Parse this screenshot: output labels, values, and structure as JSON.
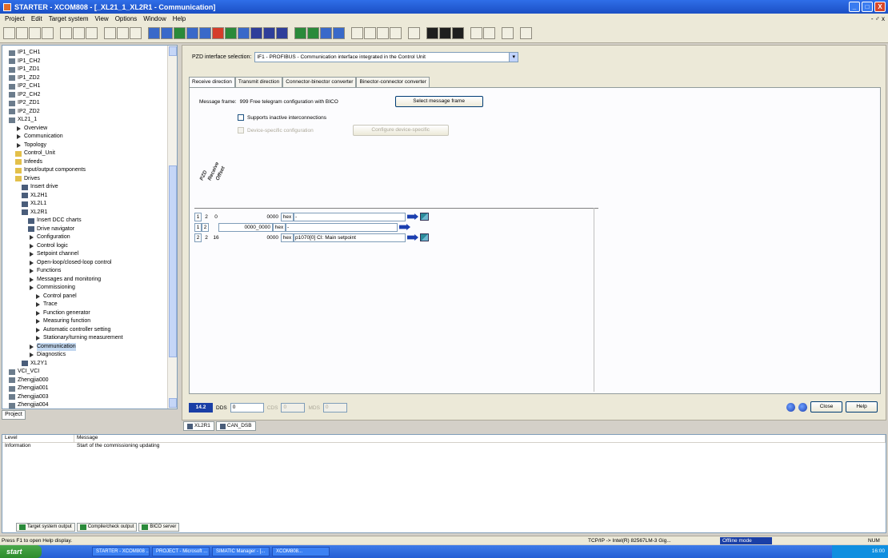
{
  "window": {
    "title": "STARTER - XCOM808 - [_XL21_1_XL2R1 - Communication]",
    "controls": [
      "_",
      "□",
      "X"
    ]
  },
  "menu": {
    "items": [
      "Project",
      "Edit",
      "Target system",
      "View",
      "Options",
      "Window",
      "Help"
    ],
    "mdi_controls": "- ♂ x"
  },
  "tree": {
    "items": [
      {
        "label": "IP1_CH1",
        "type": "device",
        "indent": 0
      },
      {
        "label": "IP1_CH2",
        "type": "device",
        "indent": 0
      },
      {
        "label": "IP1_ZD1",
        "type": "device",
        "indent": 0
      },
      {
        "label": "IP1_ZD2",
        "type": "device",
        "indent": 0
      },
      {
        "label": "IP2_CH1",
        "type": "device",
        "indent": 0
      },
      {
        "label": "IP2_CH2",
        "type": "device",
        "indent": 0
      },
      {
        "label": "IP2_ZD1",
        "type": "device",
        "indent": 0
      },
      {
        "label": "IP2_ZD2",
        "type": "device",
        "indent": 0
      },
      {
        "label": "XL21_1",
        "type": "device",
        "indent": 0
      },
      {
        "label": "Overview",
        "type": "arrow",
        "indent": 1
      },
      {
        "label": "Communication",
        "type": "arrow",
        "indent": 1
      },
      {
        "label": "Topology",
        "type": "arrow",
        "indent": 1
      },
      {
        "label": "Control_Unit",
        "type": "folder",
        "indent": 1
      },
      {
        "label": "Infeeds",
        "type": "folder",
        "indent": 1
      },
      {
        "label": "Input/output components",
        "type": "folder",
        "indent": 1
      },
      {
        "label": "Drives",
        "type": "folder",
        "indent": 1
      },
      {
        "label": "Insert drive",
        "type": "drive",
        "indent": 2
      },
      {
        "label": "XL2H1",
        "type": "drive",
        "indent": 2
      },
      {
        "label": "XL2L1",
        "type": "drive",
        "indent": 2
      },
      {
        "label": "XL2R1",
        "type": "drive",
        "indent": 2
      },
      {
        "label": "Insert DCC charts",
        "type": "drive",
        "indent": 3
      },
      {
        "label": "Drive navigator",
        "type": "drive",
        "indent": 3
      },
      {
        "label": "Configuration",
        "type": "arrow",
        "indent": 3
      },
      {
        "label": "Control logic",
        "type": "arrow",
        "indent": 3
      },
      {
        "label": "Setpoint channel",
        "type": "arrow",
        "indent": 3
      },
      {
        "label": "Open-loop/closed-loop control",
        "type": "arrow",
        "indent": 3
      },
      {
        "label": "Functions",
        "type": "arrow",
        "indent": 3
      },
      {
        "label": "Messages and monitoring",
        "type": "arrow",
        "indent": 3
      },
      {
        "label": "Commissioning",
        "type": "arrow",
        "indent": 3
      },
      {
        "label": "Control panel",
        "type": "arrow",
        "indent": 4
      },
      {
        "label": "Trace",
        "type": "arrow",
        "indent": 4
      },
      {
        "label": "Function generator",
        "type": "arrow",
        "indent": 4
      },
      {
        "label": "Measuring function",
        "type": "arrow",
        "indent": 4
      },
      {
        "label": "Automatic controller setting",
        "type": "arrow",
        "indent": 4
      },
      {
        "label": "Stationary/turning measurement",
        "type": "arrow",
        "indent": 4
      },
      {
        "label": "Communication",
        "type": "arrow",
        "indent": 3,
        "selected": true
      },
      {
        "label": "Diagnostics",
        "type": "arrow",
        "indent": 3
      },
      {
        "label": "XL2Y1",
        "type": "drive",
        "indent": 2
      },
      {
        "label": "VCI_VCI",
        "type": "device",
        "indent": 0
      },
      {
        "label": "Zhengjia000",
        "type": "device",
        "indent": 0
      },
      {
        "label": "Zhengjia001",
        "type": "device",
        "indent": 0
      },
      {
        "label": "Zhengjia003",
        "type": "device",
        "indent": 0
      },
      {
        "label": "Zhengjia004",
        "type": "device",
        "indent": 0
      }
    ],
    "project_tab": "Project"
  },
  "pzd": {
    "label": "PZD interface selection:",
    "selected": "IF1 - PROFIBUS - Communication interface integrated in the Control Unit"
  },
  "tabs": [
    {
      "label": "Receive direction",
      "active": true
    },
    {
      "label": "Transmit direction",
      "active": false
    },
    {
      "label": "Connector-binector converter",
      "active": false
    },
    {
      "label": "Binector-connector converter",
      "active": false
    }
  ],
  "message": {
    "label": "Message frame:",
    "value": "999 Free telegram configuration with BICO",
    "select_button": "Select message frame",
    "checkbox1": "Supports inactive interconnections",
    "checkbox2": "Device-specific configuration",
    "disabled_button": "Configure device-specific"
  },
  "columns": [
    "PZD",
    "Receive",
    "Offset"
  ],
  "rows": [
    {
      "pzd": "1",
      "len": "2",
      "offset": "0",
      "value": "0000",
      "hex": "hex",
      "signal": "-"
    },
    {
      "pzd": "1",
      "len": "2",
      "offset": "",
      "value": "0000_0000",
      "hex": "hex",
      "signal": "-"
    },
    {
      "pzd": "2",
      "len": "2",
      "offset": "16",
      "value": "0000",
      "hex": "hex",
      "signal": "p1070[0] CI: Main setpoint"
    }
  ],
  "status": {
    "badge": "14.2",
    "dds_label": "DDS",
    "dds_value": "0",
    "cds_label": "CDS",
    "cds_value": "0",
    "extra_label": "MDS",
    "extra_value": "0",
    "close_button": "Close",
    "help_button": "Help"
  },
  "doc_tabs": [
    "XL2R1",
    "CAN_DSB"
  ],
  "detail": {
    "headers": [
      "Level",
      "Message"
    ],
    "rows": [
      {
        "level": "Information",
        "message": "Start of the commissioning updating"
      }
    ],
    "tabs": [
      "Target system output",
      "Compile/check output",
      "BICO server"
    ]
  },
  "statusbar": {
    "help_text": "Press F1 to open Help display.",
    "interface": "TCP/IP -> Intel(R) 82567LM-3 Gig...",
    "mode": "Offline mode",
    "mode_extra": "NUM"
  },
  "taskbar": {
    "start": "start",
    "tasks": [
      "STARTER - XCOM808 ...",
      "PROJECT - Microsoft ...",
      "SIMATIC Manager - [...",
      "XCOM808..."
    ],
    "clock": "16:00"
  }
}
